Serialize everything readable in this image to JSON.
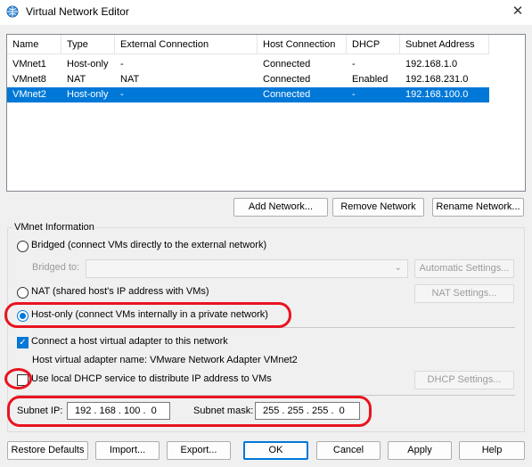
{
  "window": {
    "title": "Virtual Network Editor",
    "close_glyph": "✕",
    "icon": "globe-network-icon"
  },
  "table": {
    "headers": [
      "Name",
      "Type",
      "External Connection",
      "Host Connection",
      "DHCP",
      "Subnet Address"
    ],
    "rows": [
      [
        "VMnet1",
        "Host-only",
        "-",
        "Connected",
        "-",
        "192.168.1.0"
      ],
      [
        "VMnet8",
        "NAT",
        "NAT",
        "Connected",
        "Enabled",
        "192.168.231.0"
      ],
      [
        "VMnet2",
        "Host-only",
        "-",
        "Connected",
        "-",
        "192.168.100.0"
      ]
    ],
    "selected_row": 2
  },
  "list_buttons": {
    "add": "Add Network...",
    "remove": "Remove Network",
    "rename": "Rename Network..."
  },
  "vmnet_info": {
    "group_label": "VMnet Information",
    "bridged_label": "Bridged (connect VMs directly to the external network)",
    "bridged_to_label": "Bridged to:",
    "automatic_settings": "Automatic Settings...",
    "nat_label": "NAT (shared host's IP address with VMs)",
    "nat_settings": "NAT Settings...",
    "hostonly_label": "Host-only (connect VMs internally in a private network)",
    "connect_adapter_label": "Connect a host virtual adapter to this network",
    "adapter_name_label": "Host virtual adapter name: VMware Network Adapter VMnet2",
    "dhcp_label": "Use local DHCP service to distribute IP address to VMs",
    "dhcp_settings": "DHCP Settings...",
    "subnet_ip_label": "Subnet IP:",
    "subnet_ip_value": "192 . 168 . 100 .  0",
    "subnet_mask_label": "Subnet mask:",
    "subnet_mask_value": "255 . 255 . 255 .  0",
    "selected_mode": "host-only",
    "connect_adapter_checked": true,
    "dhcp_checked": false
  },
  "footer_buttons": {
    "restore": "Restore Defaults",
    "import": "Import...",
    "export": "Export...",
    "ok": "OK",
    "cancel": "Cancel",
    "apply": "Apply",
    "help": "Help"
  },
  "colors": {
    "selection": "#0078d7",
    "annotation": "#e8141f"
  }
}
